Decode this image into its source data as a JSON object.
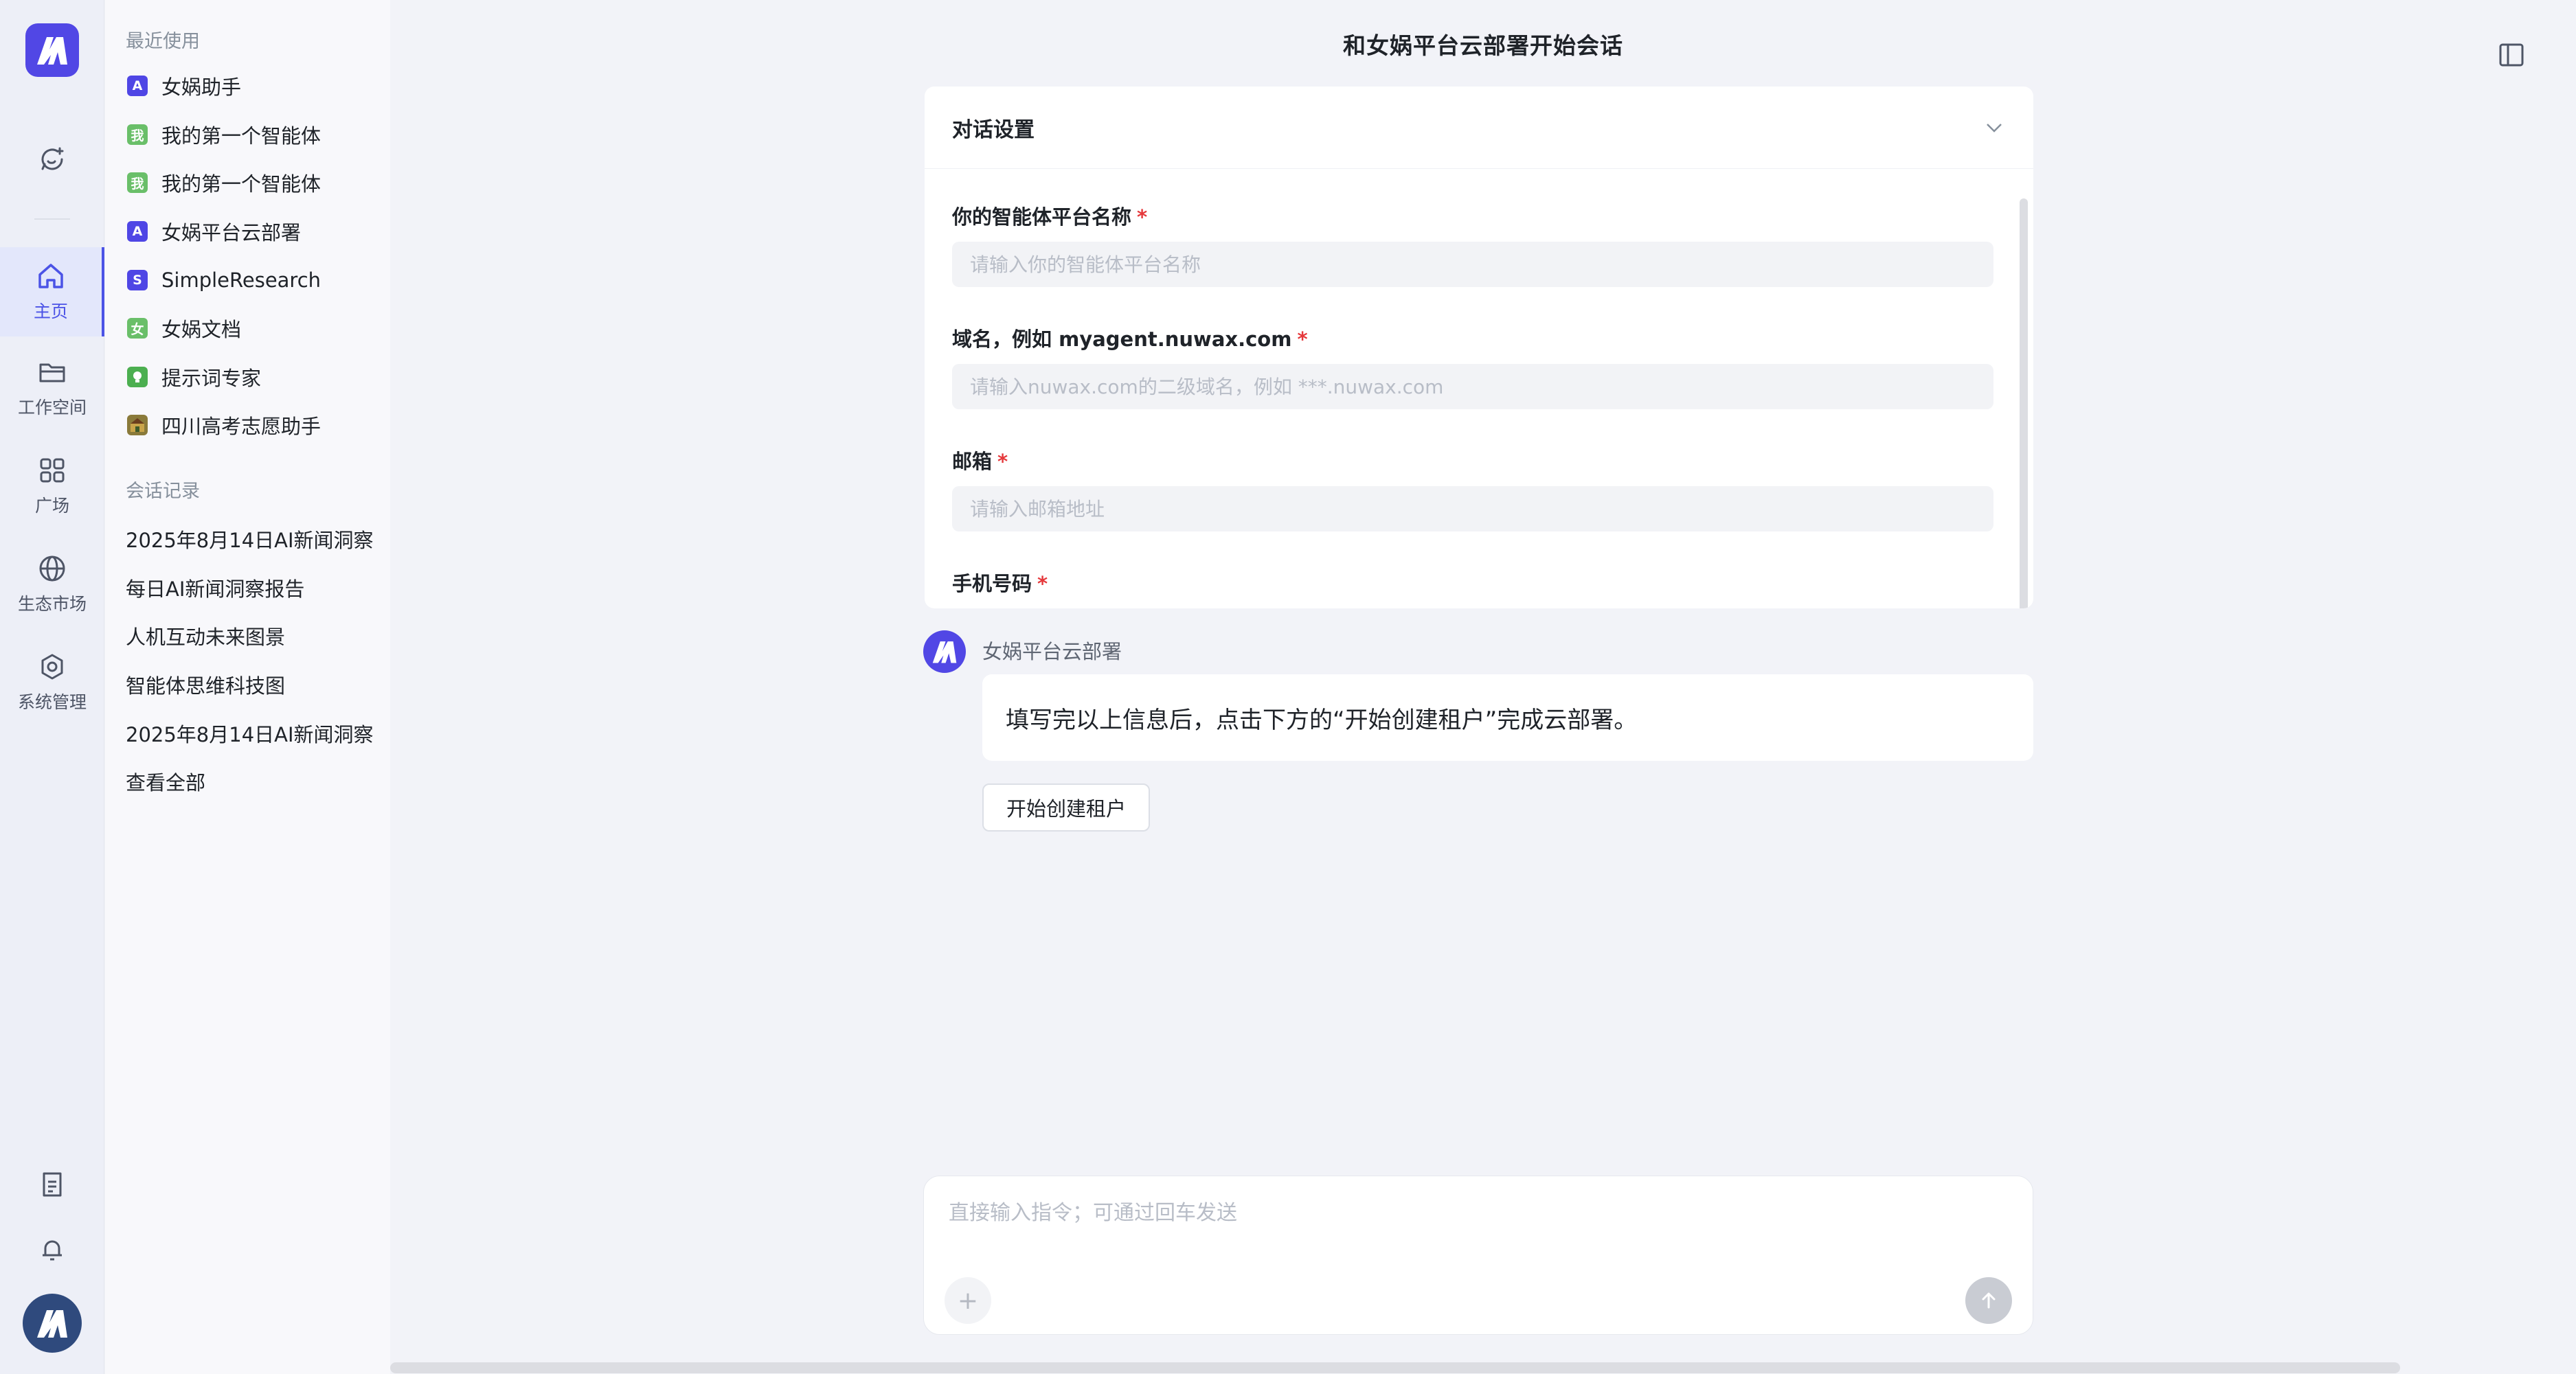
{
  "rail": {
    "logo_icon": "app-logo-icon",
    "new_chat_icon": "chat-plus-icon",
    "nav": [
      {
        "label": "主页",
        "icon": "home-icon",
        "active": true
      },
      {
        "label": "工作空间",
        "icon": "folder-icon"
      },
      {
        "label": "广场",
        "icon": "grid-icon"
      },
      {
        "label": "生态市场",
        "icon": "globe-icon"
      },
      {
        "label": "系统管理",
        "icon": "gear-icon"
      }
    ],
    "bottom": [
      "document-icon",
      "bell-icon",
      "avatar"
    ]
  },
  "panel": {
    "recent_title": "最近使用",
    "recent": [
      {
        "name": "女娲助手",
        "icon": "A",
        "color": "#4f46e5"
      },
      {
        "name": "我的第一个智能体",
        "icon": "我",
        "color": "#6abf69"
      },
      {
        "name": "我的第一个智能体",
        "icon": "我",
        "color": "#6abf69"
      },
      {
        "name": "女娲平台云部署",
        "icon": "A",
        "color": "#4f46e5"
      },
      {
        "name": "SimpleResearch",
        "icon": "S",
        "color": "#4f46e5"
      },
      {
        "name": "女娲文档",
        "icon": "女",
        "color": "#6abf69"
      },
      {
        "name": "提示词专家",
        "icon": "💡",
        "color": "#4caf50"
      },
      {
        "name": "四川高考志愿助手",
        "icon": "校",
        "color": "#8a7a3a"
      }
    ],
    "history_title": "会话记录",
    "history": [
      "2025年8月14日AI新闻洞察",
      "每日AI新闻洞察报告",
      "人机互动未来图景",
      "智能体思维科技图",
      "2025年8月14日AI新闻洞察"
    ],
    "view_all": "查看全部"
  },
  "main": {
    "title": "和女娲平台云部署开始会话",
    "settings": {
      "header": "对话设置",
      "fields": [
        {
          "label": "你的智能体平台名称",
          "placeholder": "请输入你的智能体平台名称"
        },
        {
          "label": "域名，例如 myagent.nuwax.com",
          "placeholder": "请输入nuwax.com的二级域名，例如 ***.nuwax.com"
        },
        {
          "label": "邮箱",
          "placeholder": "请输入邮箱地址"
        },
        {
          "label": "手机号码"
        }
      ]
    },
    "message": {
      "sender": "女娲平台云部署",
      "text": "填写完以上信息后，点击下方的“开始创建租户”完成云部署。",
      "button": "开始创建租户"
    },
    "composer": {
      "placeholder": "直接输入指令；可通过回车发送",
      "plus": "+"
    }
  },
  "colors": {
    "accent": "#4b53e6",
    "required": "#e5383b"
  }
}
